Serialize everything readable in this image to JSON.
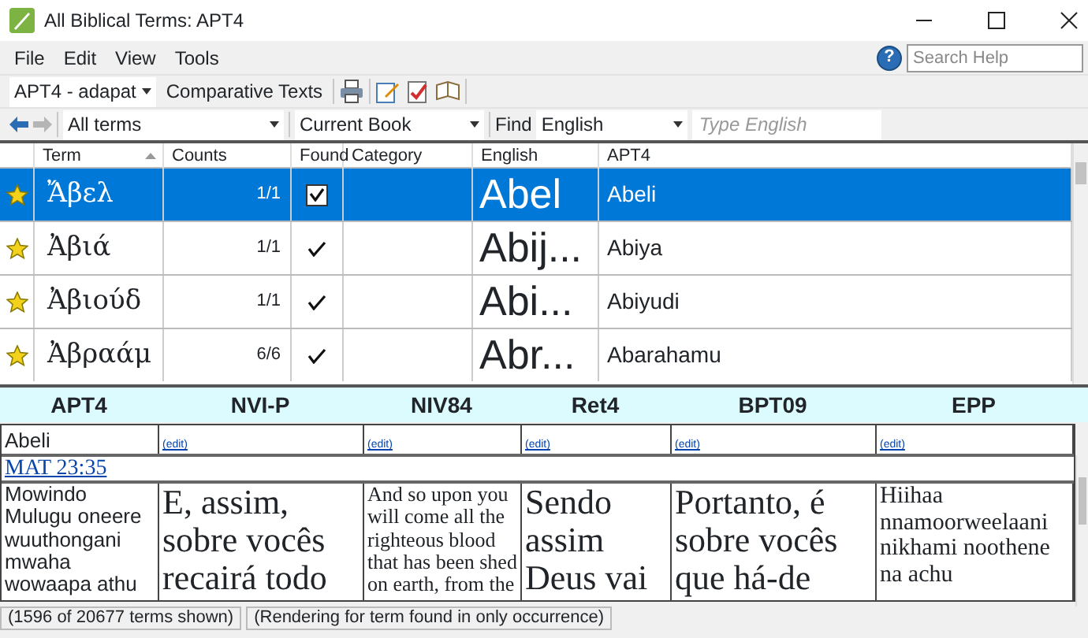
{
  "window": {
    "title": "All Biblical Terms: APT4"
  },
  "menu": [
    "File",
    "Edit",
    "View",
    "Tools"
  ],
  "help": {
    "glyph": "?",
    "placeholder": "Search Help"
  },
  "toolbar": {
    "project": "APT4 - adapat",
    "comparative": "Comparative Texts"
  },
  "filter_bar": {
    "terms": "All terms",
    "scope": "Current Book",
    "find_label": "Find",
    "language": "English",
    "placeholder": "Type English"
  },
  "grid": {
    "columns": [
      "Term",
      "Counts",
      "Found",
      "Category",
      "English",
      "APT4"
    ],
    "rows": [
      {
        "selected": true,
        "term": "Ἄβελ",
        "counts": "1/1",
        "found": true,
        "english": "Abel",
        "apt4": "Abeli"
      },
      {
        "selected": false,
        "term": "Ἀβιά",
        "counts": "1/1",
        "found": true,
        "english": "Abij...",
        "apt4": "Abiya"
      },
      {
        "selected": false,
        "term": "Ἀβιούδ",
        "counts": "1/1",
        "found": true,
        "english": "Abi...",
        "apt4": "Abiyudi"
      },
      {
        "selected": false,
        "term": "Ἀβραάμ",
        "counts": "6/6",
        "found": true,
        "english": "Abr...",
        "apt4": "Abarahamu"
      }
    ]
  },
  "comparative": {
    "columns": [
      "APT4",
      "NVI-P",
      "NIV84",
      "Ret4",
      "BPT09",
      "EPP"
    ],
    "renderings": [
      {
        "kind": "text",
        "text": "Abeli"
      },
      {
        "kind": "link",
        "text": "(edit)"
      },
      {
        "kind": "link",
        "text": "(edit)"
      },
      {
        "kind": "link",
        "text": "(edit)"
      },
      {
        "kind": "link",
        "text": "(edit)"
      },
      {
        "kind": "link",
        "text": "(edit)"
      }
    ],
    "reference": "MAT 23:35",
    "passages": [
      "Mowindo Mulugu oneere wuuthongani mwaha wowaapa athu",
      "E, assim, sobre vocês recairá todo",
      "And so upon you will come all the righteous blood that has been shed on earth, from the",
      "Sendo assim Deus vai",
      "Portanto, é sobre vocês que há-de",
      "Hiihaa nnamoorweelaani nikhami noothene na achu"
    ]
  },
  "status_bar": [
    "(1596 of 20677 terms shown)",
    "(Rendering for term found in only occurrence)"
  ]
}
